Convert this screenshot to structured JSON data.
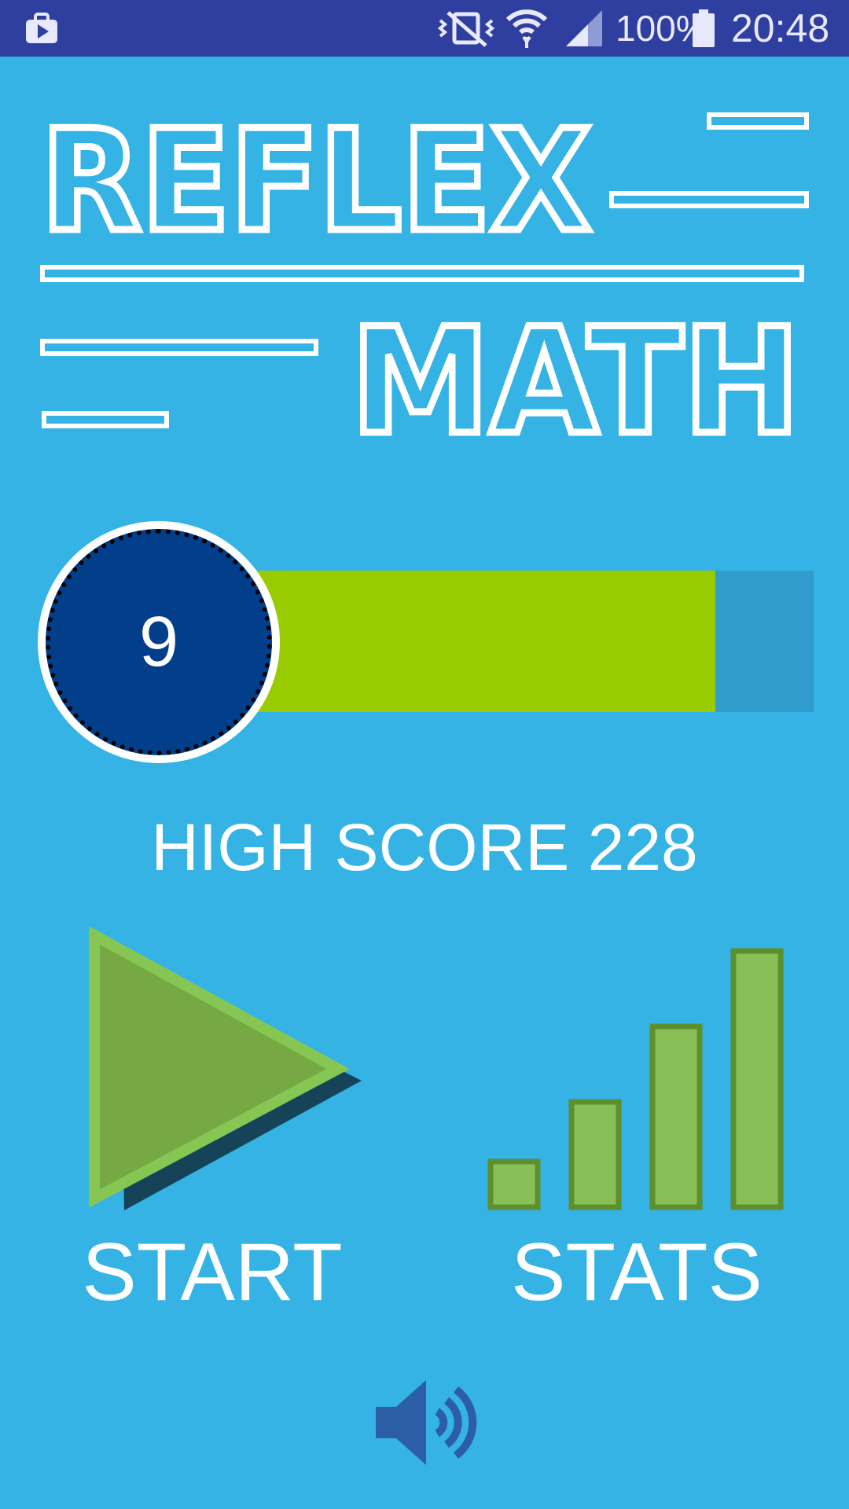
{
  "status_bar": {
    "battery": "100%",
    "time": "20:48",
    "icons": [
      "work-briefcase-icon",
      "vibrate-off-icon",
      "wifi-icon",
      "signal-icon",
      "battery-icon"
    ]
  },
  "logo": {
    "line1": "REFLEX",
    "line2": "MATH"
  },
  "level": {
    "value": "9",
    "progress": 0.83
  },
  "high_score": {
    "text": "HIGH SCORE 228"
  },
  "buttons": {
    "start_label": "START",
    "stats_label": "STATS"
  },
  "sound": {
    "icon": "speaker-on-icon"
  },
  "colors": {
    "background": "#34b3e4",
    "status_bar": "#2e3f9f",
    "progress_fill": "#99cc00",
    "level_badge": "#023e8a",
    "play_button": "#76a943",
    "stats_bars": "#88c057"
  }
}
